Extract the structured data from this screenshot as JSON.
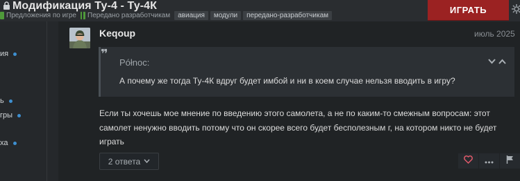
{
  "header": {
    "title": "Модификация Ту-4 - Ту-4К",
    "breadcrumbs": [
      {
        "label": "Предложения по игре"
      },
      {
        "label": "Передано разработчикам"
      }
    ],
    "tags": [
      "авиация",
      "модули",
      "передано-разработчикам"
    ],
    "play_label": "ИГРАТЬ",
    "play_color": "#9b2222"
  },
  "sidebar": {
    "items": [
      {
        "label": "ия"
      },
      {
        "label": "ь"
      },
      {
        "label": "гры"
      },
      {
        "label": "ха"
      }
    ],
    "dot_color": "#3e8fd0"
  },
  "post": {
    "author": "Keqoup",
    "date": "июль 2025",
    "quote": {
      "source": "Północ:",
      "text": "А почему же тогда Ту-4К вдруг будет имбой и ни в коем случае нельзя вводить в игру?"
    },
    "body_lines": [
      "Если ты хочешь мое мнение по введению этого самолета, а не по каким-то смежным вопросам: этот",
      "самолет ненужно вводить потому что он скорее всего будет бесполезным г, на котором никто не будет",
      "играть"
    ],
    "replies_label": "2 ответа",
    "like_color": "#e05a6a"
  }
}
